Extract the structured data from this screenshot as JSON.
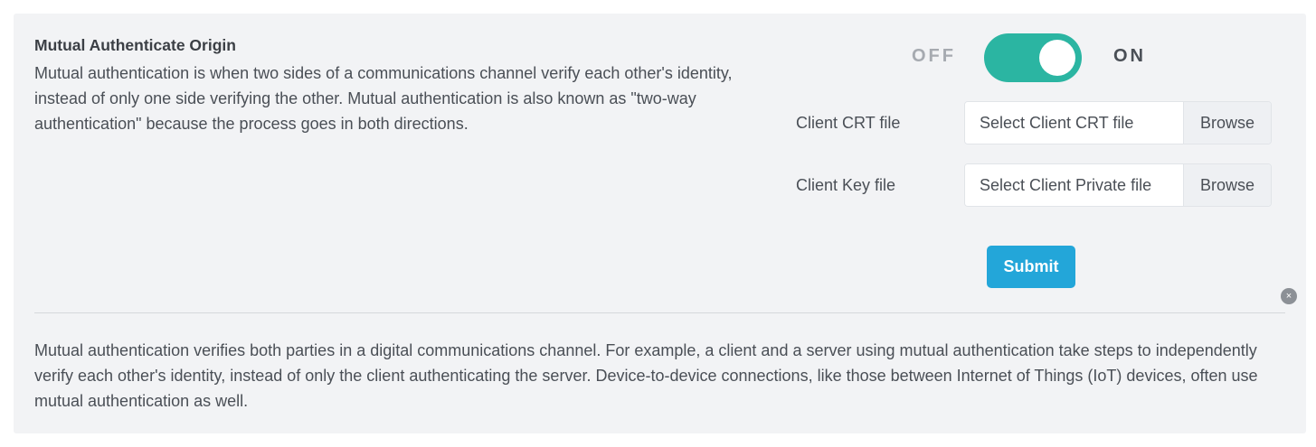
{
  "section": {
    "title": "Mutual Authenticate Origin",
    "description": "Mutual authentication is when two sides of a communications channel verify each other's identity, instead of only one side verifying the other. Mutual authentication is also known as \"two-way authentication\" because the process goes in both directions."
  },
  "toggle": {
    "off_label": "OFF",
    "on_label": "ON",
    "state": "on",
    "color": "#2bb5a2"
  },
  "form": {
    "crt": {
      "label": "Client CRT file",
      "placeholder": "Select Client CRT file",
      "browse_label": "Browse"
    },
    "key": {
      "label": "Client Key file",
      "placeholder": "Select Client Private file",
      "browse_label": "Browse"
    },
    "submit_label": "Submit",
    "submit_color": "#23a6d9"
  },
  "close_icon": {
    "name": "close-icon",
    "glyph": "×"
  },
  "footer": {
    "text": "Mutual authentication verifies both parties in a digital communications channel. For example, a client and a server using mutual authentication take steps to independently verify each other's identity, instead of only the client authenticating the server. Device-to-device connections, like those between Internet of Things (IoT) devices, often use mutual authentication as well."
  }
}
